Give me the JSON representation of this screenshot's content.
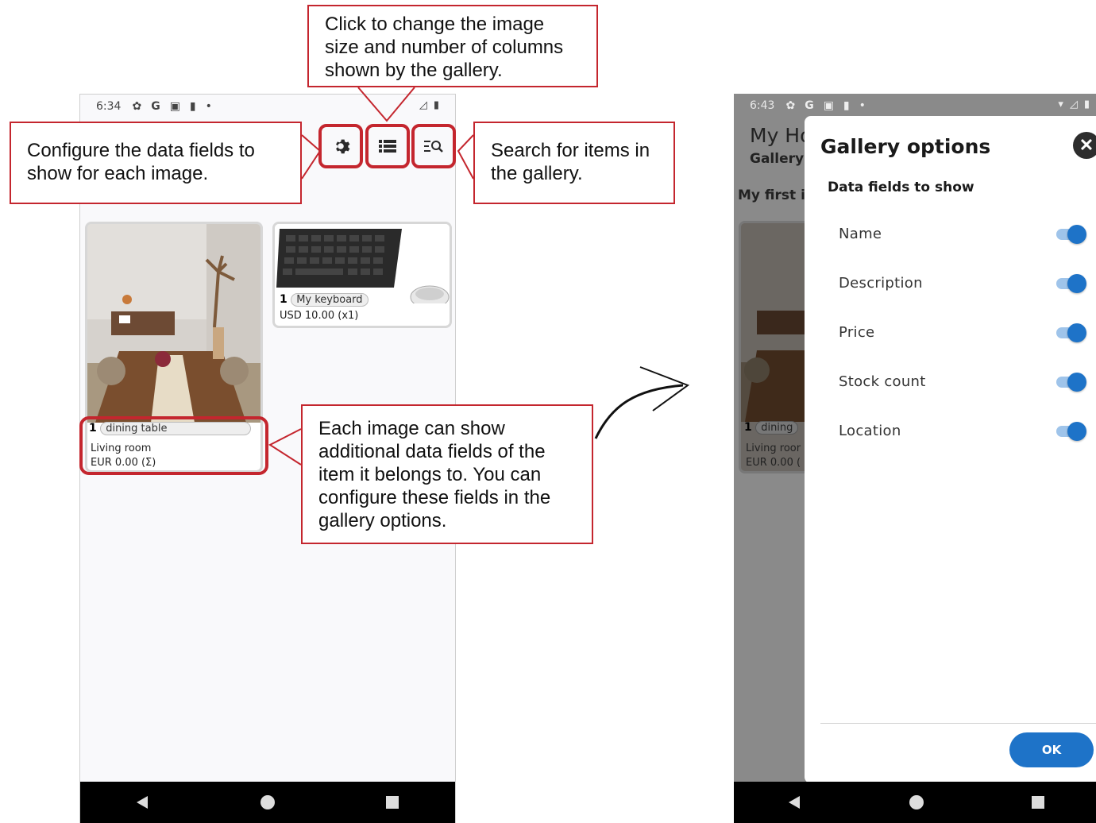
{
  "left_phone": {
    "status_time": "6:34",
    "status_icons": [
      "gear-icon",
      "google-icon",
      "sim-icon",
      "sd-icon",
      "dot-icon"
    ],
    "toolbar": {
      "settings_icon": "gear-icon",
      "list_icon": "list-icon",
      "search_icon": "search-list-icon"
    },
    "cards": [
      {
        "count": "1",
        "name": "dining table",
        "location": "Living room",
        "price": "EUR 0.00 (Σ)"
      },
      {
        "count": "1",
        "name": "My keyboard",
        "price": "USD 10.00 (x1)"
      }
    ]
  },
  "callouts": {
    "columns": "Click to change the image size and number of columns shown by the gallery.",
    "fields": "Configure the data fields to show for each image.",
    "search": "Search for items in the gallery.",
    "data": "Each image can show additional data fields of the item it belongs to. You can configure these fields in the gallery options."
  },
  "right_phone": {
    "status_time": "6:43",
    "bg_title": "My Ho",
    "bg_subtitle": "Gallery",
    "bg_section": "My first ir",
    "bg_card": {
      "count": "1",
      "name": "dining",
      "location": "Living roor",
      "price": "EUR 0.00 ("
    },
    "dialog": {
      "title": "Gallery options",
      "subtitle": "Data fields to show",
      "options": [
        {
          "label": "Name",
          "enabled": true
        },
        {
          "label": "Description",
          "enabled": true
        },
        {
          "label": "Price",
          "enabled": true
        },
        {
          "label": "Stock count",
          "enabled": true
        },
        {
          "label": "Location",
          "enabled": true
        }
      ],
      "ok_label": "OK"
    }
  },
  "colors": {
    "accent": "#c4262e",
    "primary": "#1e73c8"
  }
}
